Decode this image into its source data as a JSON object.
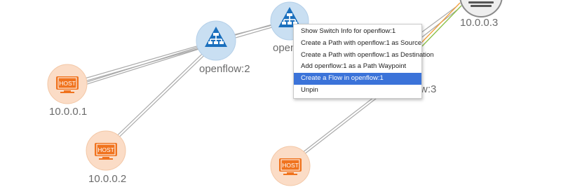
{
  "nodes": {
    "switch_openflow_1": {
      "label": "openflow:1",
      "visible_label": "openf",
      "type": "switch",
      "icon": "switch-icon"
    },
    "switch_openflow_2": {
      "label": "openflow:2",
      "type": "switch",
      "icon": "switch-icon"
    },
    "switch_openflow_3": {
      "label_fragment": "w:3",
      "type": "switch"
    },
    "host_10_0_0_1": {
      "label": "10.0.0.1",
      "badge": "HOST",
      "icon": "monitor-icon"
    },
    "host_10_0_0_2": {
      "label": "10.0.0.2",
      "badge": "HOST",
      "icon": "monitor-icon"
    },
    "host_bottom": {
      "badge": "HOST",
      "icon": "monitor-icon"
    },
    "host_10_0_0_3": {
      "label": "10.0.0.3",
      "icon": "host-icon"
    }
  },
  "context_menu": {
    "items": [
      {
        "label": "Show Switch Info for openflow:1",
        "active": false
      },
      {
        "label": "Create a Path with openflow:1 as Source",
        "active": false
      },
      {
        "label": "Create a Path with openflow:1 as Destination",
        "active": false
      },
      {
        "label": "Add openflow:1 as a Path Waypoint",
        "active": false
      },
      {
        "label": "Create a Flow in openflow:1",
        "active": true
      },
      {
        "label": "Unpin",
        "active": false
      }
    ]
  },
  "colors": {
    "switch_fill": "#1a6fbd",
    "switch_halo": "#c9dff2",
    "host_fill": "#f0731e",
    "host_halo": "#fbdcc6",
    "link": "#a9a9a9",
    "menu_highlight": "#3b73d9",
    "label": "#6b6b6b"
  }
}
